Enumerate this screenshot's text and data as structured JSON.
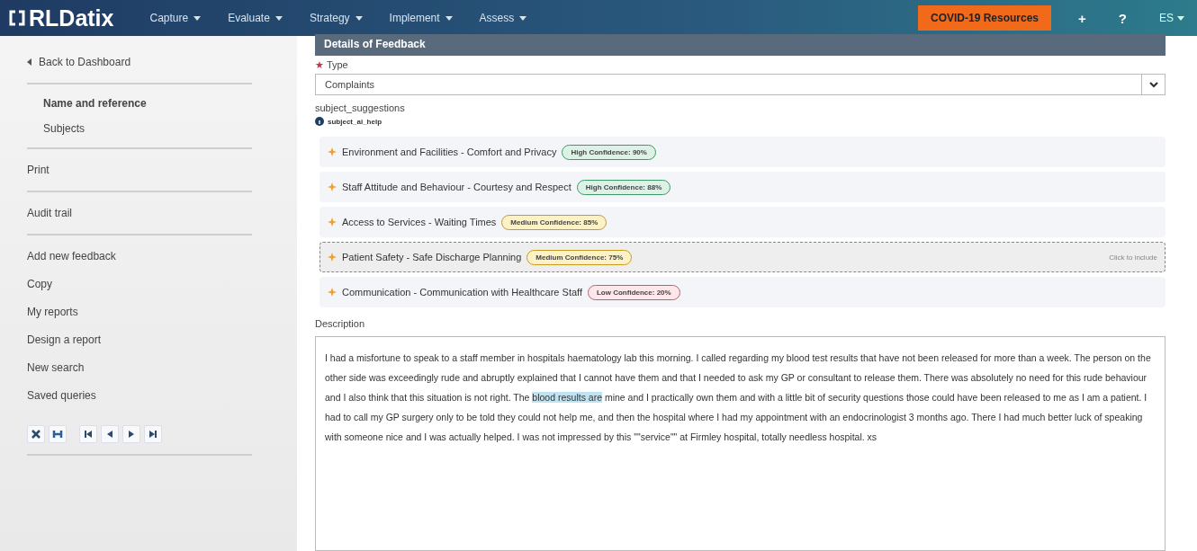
{
  "topbar": {
    "logo": "RLDatix",
    "menus": [
      {
        "label": "Capture"
      },
      {
        "label": "Evaluate"
      },
      {
        "label": "Strategy"
      },
      {
        "label": "Implement"
      },
      {
        "label": "Assess"
      }
    ],
    "covid_button": "COVID-19 Resources",
    "add": "+",
    "help": "?",
    "language": "ES"
  },
  "sidebar": {
    "back": "Back to Dashboard",
    "groups": [
      {
        "indented": true,
        "items": [
          {
            "label": "Name and reference",
            "selected": true
          },
          {
            "label": "Subjects",
            "selected": false
          }
        ]
      },
      {
        "indented": false,
        "items": [
          {
            "label": "Print",
            "selected": false
          }
        ]
      },
      {
        "indented": false,
        "items": [
          {
            "label": "Audit trail",
            "selected": false
          }
        ]
      },
      {
        "indented": false,
        "items": [
          {
            "label": "Add new feedback",
            "selected": false
          },
          {
            "label": "Copy",
            "selected": false
          },
          {
            "label": "My reports",
            "selected": false
          },
          {
            "label": "Design a report",
            "selected": false
          },
          {
            "label": "New search",
            "selected": false
          },
          {
            "label": "Saved queries",
            "selected": false
          }
        ]
      }
    ],
    "toolbar": [
      {
        "kind": "close"
      },
      {
        "kind": "save"
      },
      {
        "kind": "first"
      },
      {
        "kind": "previous"
      },
      {
        "kind": "next"
      },
      {
        "kind": "last"
      }
    ]
  },
  "section": {
    "title": "Details of Feedback"
  },
  "type_field": {
    "label": "Type",
    "required_mark": "★",
    "value": "Complaints"
  },
  "subject_suggestions": {
    "label": "subject_suggestions",
    "help": "subject_ai_help",
    "items": [
      {
        "label": "Environment and Facilities - Comfort and Privacy",
        "confidence": "High Confidence: 90%",
        "kind": "high",
        "hovered": false
      },
      {
        "label": "Staff Attitude and Behaviour - Courtesy and Respect",
        "confidence": "High Confidence: 88%",
        "kind": "high",
        "hovered": false
      },
      {
        "label": "Access to Services - Waiting Times",
        "confidence": "Medium Confidence: 85%",
        "kind": "medium",
        "hovered": false
      },
      {
        "label": "Patient Safety - Safe Discharge Planning",
        "confidence": "Medium Confidence: 75%",
        "kind": "medium",
        "hovered": true,
        "hint": "Click to include"
      },
      {
        "label": "Communication - Communication with Healthcare Staff",
        "confidence": "Low Confidence: 20%",
        "kind": "low",
        "hovered": false
      }
    ]
  },
  "description": {
    "label": "Description",
    "segments": [
      {
        "text": "I had a misfortune to speak to a staff member in hospitals haematology lab this morning. I called regarding my blood test results that have not been released for more than a week. The person on the other side was exceedingly rude and abruptly explained that I cannot have them and that I needed to ask my GP or consultant to release them. There was absolutely no need for this rude behaviour and I also think that this situation is not right. The ",
        "highlighted": false
      },
      {
        "text": "blood results are",
        "highlighted": true
      },
      {
        "text": " mine and I practically own them and with a little bit of security questions those could have been released to me as I am a patient. I had to call my GP surgery only to be told they could not help me, and then the hospital where I had my appointment with an endocrinologist 3 months ago. There I had much better luck of speaking with someone nice and I was actually helped. I was not impressed by this \"\"service\"\" at Firmley hospital, totally needless hospital. xs",
        "highlighted": false
      }
    ]
  }
}
